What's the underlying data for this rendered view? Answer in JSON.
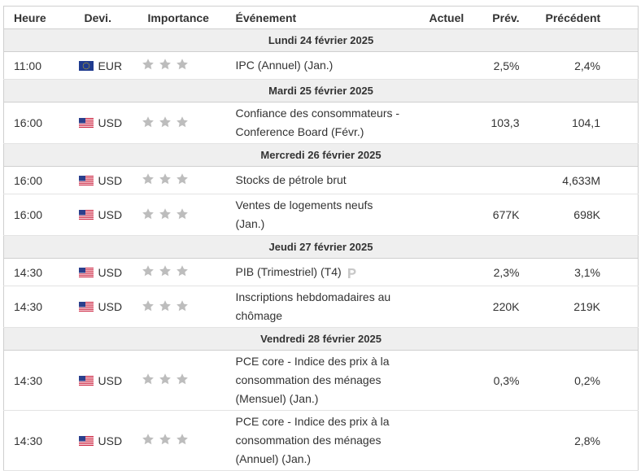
{
  "headers": {
    "time": "Heure",
    "currency": "Devi.",
    "importance": "Importance",
    "event": "Événement",
    "actual": "Actuel",
    "forecast": "Prév.",
    "previous": "Précédent"
  },
  "colors": {
    "star": "#bdbdbd",
    "day_bg": "#efefef",
    "border": "#cfcfcf",
    "preliminary_badge": "#c8c8c8"
  },
  "days": [
    {
      "label": "Lundi 24 février 2025",
      "events": [
        {
          "time": "11:00",
          "currency": "EUR",
          "flag": "eu-flag-icon",
          "importance": 3,
          "event": "IPC (Annuel) (Jan.)",
          "actual": "",
          "forecast": "2,5%",
          "previous": "2,4%",
          "preliminary": false
        }
      ]
    },
    {
      "label": "Mardi 25 février 2025",
      "events": [
        {
          "time": "16:00",
          "currency": "USD",
          "flag": "us-flag-icon",
          "importance": 3,
          "event": "Confiance des consommateurs - Conference Board (Févr.)",
          "actual": "",
          "forecast": "103,3",
          "previous": "104,1",
          "preliminary": false
        }
      ]
    },
    {
      "label": "Mercredi 26 février 2025",
      "events": [
        {
          "time": "16:00",
          "currency": "USD",
          "flag": "us-flag-icon",
          "importance": 3,
          "event": "Stocks de pétrole brut",
          "actual": "",
          "forecast": "",
          "previous": "4,633M",
          "preliminary": false
        },
        {
          "time": "16:00",
          "currency": "USD",
          "flag": "us-flag-icon",
          "importance": 3,
          "event": "Ventes de logements neufs (Jan.)",
          "actual": "",
          "forecast": "677K",
          "previous": "698K",
          "preliminary": false
        }
      ]
    },
    {
      "label": "Jeudi 27 février 2025",
      "events": [
        {
          "time": "14:30",
          "currency": "USD",
          "flag": "us-flag-icon",
          "importance": 3,
          "event": "PIB (Trimestriel) (T4)",
          "actual": "",
          "forecast": "2,3%",
          "previous": "3,1%",
          "preliminary": true
        },
        {
          "time": "14:30",
          "currency": "USD",
          "flag": "us-flag-icon",
          "importance": 3,
          "event": "Inscriptions hebdomadaires au chômage",
          "actual": "",
          "forecast": "220K",
          "previous": "219K",
          "preliminary": false
        }
      ]
    },
    {
      "label": "Vendredi 28 février 2025",
      "events": [
        {
          "time": "14:30",
          "currency": "USD",
          "flag": "us-flag-icon",
          "importance": 3,
          "event": "PCE core - Indice des prix à la consommation des ménages (Mensuel) (Jan.)",
          "actual": "",
          "forecast": "0,3%",
          "previous": "0,2%",
          "preliminary": false
        },
        {
          "time": "14:30",
          "currency": "USD",
          "flag": "us-flag-icon",
          "importance": 3,
          "event": "PCE core - Indice des prix à la consommation des ménages (Annuel) (Jan.)",
          "actual": "",
          "forecast": "",
          "previous": "2,8%",
          "preliminary": false
        }
      ]
    }
  ]
}
